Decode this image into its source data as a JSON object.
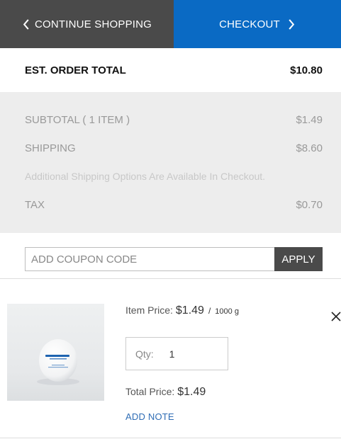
{
  "nav": {
    "continue_label": "CONTINUE SHOPPING",
    "checkout_label": "CHECKOUT",
    "continue_icon": "chevron-left-icon",
    "checkout_icon": "chevron-right-icon"
  },
  "order_total": {
    "label": "EST. ORDER TOTAL",
    "value": "$10.80"
  },
  "summary": {
    "subtotal_label": "SUBTOTAL ( 1 ITEM )",
    "subtotal_value": "$1.49",
    "shipping_label": "SHIPPING",
    "shipping_value": "$8.60",
    "shipping_note": "Additional Shipping Options Are Available In Checkout.",
    "tax_label": "TAX",
    "tax_value": "$0.70"
  },
  "coupon": {
    "placeholder": "ADD COUPON CODE",
    "value": "",
    "apply_label": "APPLY"
  },
  "item": {
    "price_label": "Item Price:",
    "price_value": "$1.49",
    "price_sep": "/",
    "unit": "1000 g",
    "qty_label": "Qty:",
    "qty_value": "1",
    "total_label": "Total Price:",
    "total_value": "$1.49",
    "add_note_label": "ADD NOTE",
    "remove_icon": "close-icon"
  },
  "colors": {
    "continue_bg": "#4a4a4a",
    "checkout_bg": "#0a6ac4",
    "summary_bg": "#ededed",
    "link": "#2f6db5"
  }
}
